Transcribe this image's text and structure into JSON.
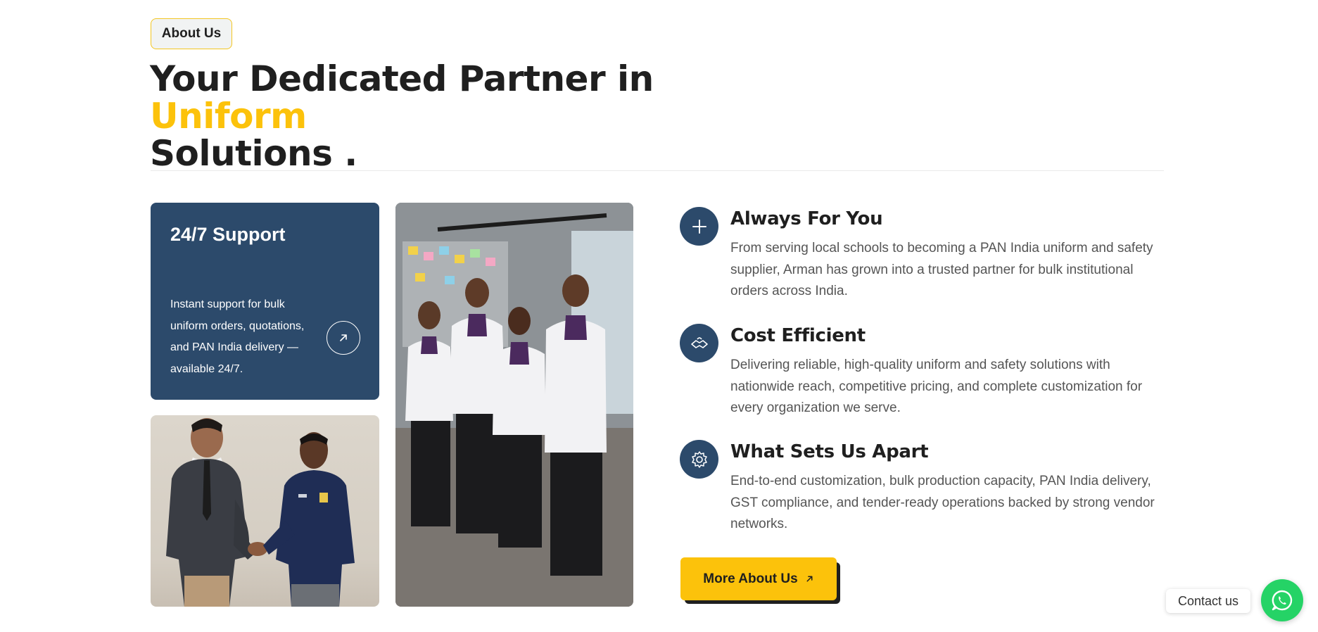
{
  "section_badge": "About Us",
  "heading": {
    "part1": "Your Dedicated Partner in ",
    "highlight": "Uniform",
    "part2": "Solutions ."
  },
  "support_card": {
    "title": "24/7 Support",
    "text": "Instant support for bulk uniform orders, quotations, and PAN India delivery — available 24/7.",
    "arrow_icon": "arrow-up-right-icon"
  },
  "features": [
    {
      "icon": "plus-icon",
      "title": "Always For You",
      "text": "From serving local schools to becoming a PAN India uniform and safety supplier, Arman has grown into a trusted partner for bulk institutional orders across India."
    },
    {
      "icon": "handshake-icon",
      "title": "Cost Efficient",
      "text": "Delivering reliable, high-quality uniform and safety solutions with nationwide reach, competitive pricing, and complete customization for every organization we serve."
    },
    {
      "icon": "gear-icon",
      "title": "What Sets Us Apart",
      "text": "End-to-end customization, bulk production capacity, PAN India delivery, GST compliance, and tender-ready operations backed by strong vendor networks."
    }
  ],
  "cta": {
    "label": "More About Us",
    "icon": "arrow-up-right-icon"
  },
  "contact_widget": {
    "label": "Contact us",
    "icon": "whatsapp-icon"
  },
  "colors": {
    "accent": "#fcc20b",
    "navy": "#2c4a6b",
    "whatsapp": "#25d366"
  }
}
